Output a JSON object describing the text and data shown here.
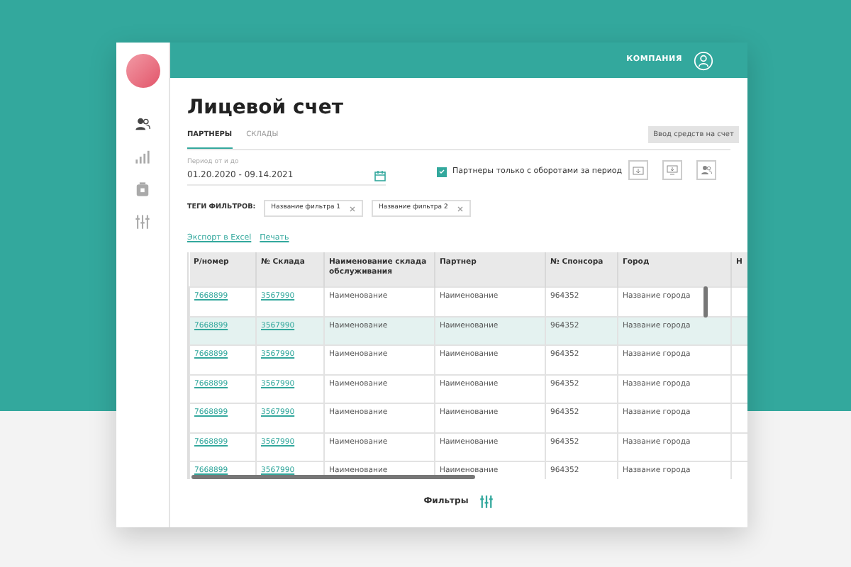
{
  "header": {
    "company": "КОМПАНИЯ"
  },
  "sidebar": {
    "items": [
      {
        "kind": "users",
        "selected": true
      },
      {
        "kind": "chart",
        "selected": false
      },
      {
        "kind": "wallet",
        "selected": false
      },
      {
        "kind": "filters",
        "selected": false
      }
    ]
  },
  "title": "Лицевой счет",
  "tabs": [
    {
      "label": "ПАРТНЕРЫ",
      "selected": true
    },
    {
      "label": "СКЛАДЫ",
      "selected": false
    }
  ],
  "period": {
    "label": "Период от и до",
    "value": "01.20.2020 - 09.14.2021"
  },
  "only_with_turnover": {
    "label": "Партнеры только с оборотами за период",
    "checked": true
  },
  "tooltip": "Ввод средств на счет",
  "actions": [
    {
      "kind": "deposit"
    },
    {
      "kind": "monitor"
    },
    {
      "kind": "users"
    }
  ],
  "filter_tags": {
    "label": "ТЕГИ ФИЛЬТРОВ:",
    "tags": [
      "Название фильтра 1",
      "Название фильтра 2"
    ]
  },
  "links": [
    "Экспорт в Excel",
    "Печать"
  ],
  "table": {
    "columns": [
      "Р/номер",
      "№ Склада",
      "Наименование склада обслуживания",
      "Партнер",
      "№ Спонсора",
      "Город",
      "Н"
    ],
    "rows": [
      {
        "cells": [
          "7668899",
          "3567990",
          "Наименование",
          "Наименование",
          "964352",
          "Название города"
        ],
        "selected": false
      },
      {
        "cells": [
          "7668899",
          "3567990",
          "Наименование",
          "Наименование",
          "964352",
          "Название города"
        ],
        "selected": true
      },
      {
        "cells": [
          "7668899",
          "3567990",
          "Наименование",
          "Наименование",
          "964352",
          "Название города"
        ],
        "selected": false
      },
      {
        "cells": [
          "7668899",
          "3567990",
          "Наименование",
          "Наименование",
          "964352",
          "Название города"
        ],
        "selected": false
      },
      {
        "cells": [
          "7668899",
          "3567990",
          "Наименование",
          "Наименование",
          "964352",
          "Название города"
        ],
        "selected": false
      },
      {
        "cells": [
          "7668899",
          "3567990",
          "Наименование",
          "Наименование",
          "964352",
          "Название города"
        ],
        "selected": false
      },
      {
        "cells": [
          "7668899",
          "3567990",
          "Наименование",
          "Наименование",
          "964352",
          "Название города"
        ],
        "selected": false
      }
    ]
  },
  "footer": {
    "label": "Фильтры"
  }
}
